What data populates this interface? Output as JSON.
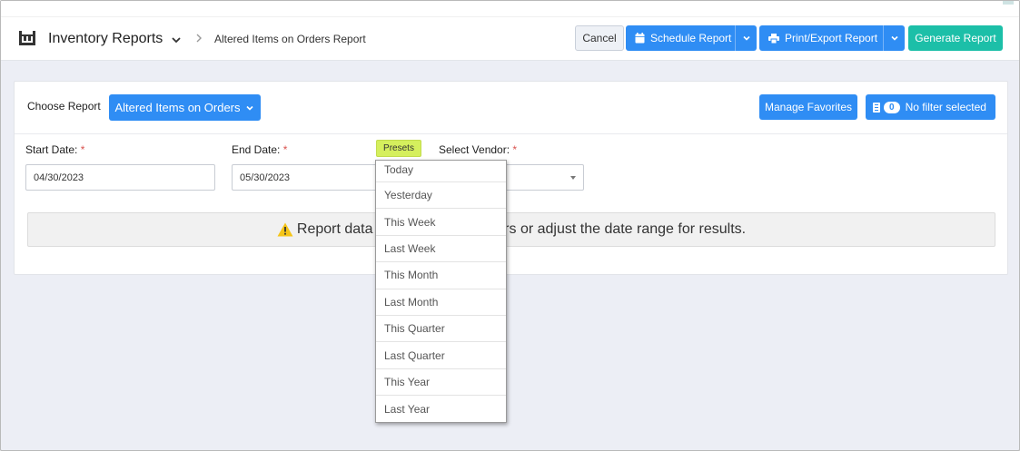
{
  "header": {
    "app_title": "Inventory Reports",
    "breadcrumb": "Altered Items on Orders Report",
    "cancel_label": "Cancel",
    "schedule_label": "Schedule Report",
    "print_label": "Print/Export Report",
    "generate_label": "Generate Report"
  },
  "toolbar": {
    "choose_label": "Choose Report",
    "report_selected": "Altered Items on Orders",
    "favorites_label": "Manage Favorites",
    "filter_count": "0",
    "filter_label": "No filter selected"
  },
  "filters": {
    "start_label": "Start Date:",
    "start_value": "04/30/2023",
    "end_label": "End Date:",
    "end_value": "05/30/2023",
    "presets_label": "Presets",
    "vendor_label": "Select Vendor:",
    "required_mark": "*"
  },
  "notice": {
    "text": "Report data is empty. Adjust filters or adjust the date range for results."
  },
  "presets": [
    "Today",
    "Yesterday",
    "This Week",
    "Last Week",
    "This Month",
    "Last Month",
    "This Quarter",
    "Last Quarter",
    "This Year",
    "Last Year"
  ],
  "colors": {
    "primary": "#2f8df4",
    "success": "#1cbfa8",
    "presets_highlight": "#d5ef5d",
    "required": "#d9534f",
    "warning": "#f5c518"
  }
}
